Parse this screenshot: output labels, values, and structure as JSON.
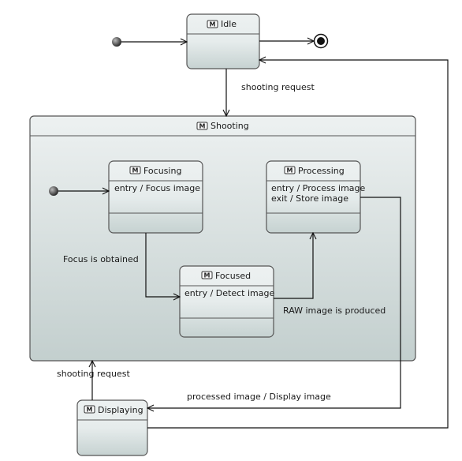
{
  "diagram": {
    "states": {
      "idle": {
        "name": "Idle"
      },
      "shooting": {
        "name": "Shooting"
      },
      "focusing": {
        "name": "Focusing",
        "actions": [
          "entry / Focus image"
        ]
      },
      "processing": {
        "name": "Processing",
        "actions": [
          "entry / Process image",
          "exit / Store image"
        ]
      },
      "focused": {
        "name": "Focused",
        "actions": [
          "entry / Detect image"
        ]
      },
      "displaying": {
        "name": "Displaying"
      }
    },
    "state_icon": "M",
    "transitions": {
      "idle_to_shooting": "shooting request",
      "focusing_to_focused": "Focus is obtained",
      "focused_to_processing": "RAW image is produced",
      "displaying_to_shooting": "shooting request",
      "processing_to_displaying": "processed image / Display image"
    }
  },
  "colors": {
    "state_top": "#eaeeee",
    "state_bottom": "#c6d2d1",
    "line": "#111111"
  }
}
